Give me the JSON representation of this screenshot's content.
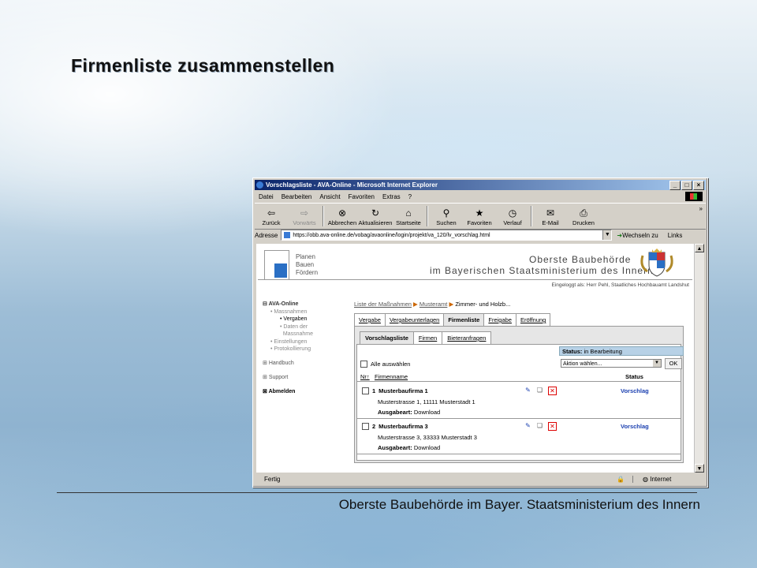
{
  "slide": {
    "title": "Firmenliste zusammenstellen",
    "footer": "Oberste Baubehörde im Bayer. Staatsministerium des Innern"
  },
  "window": {
    "title": "Vorschlagsliste - AVA-Online - Microsoft Internet Explorer",
    "menu": [
      "Datei",
      "Bearbeiten",
      "Ansicht",
      "Favoriten",
      "Extras",
      "?"
    ],
    "toolbar": [
      {
        "label": "Zurück",
        "icon": "back-arrow-icon",
        "glyph": "⇦"
      },
      {
        "label": "Vorwärts",
        "icon": "forward-arrow-icon",
        "glyph": "⇨"
      },
      {
        "label": "Abbrechen",
        "icon": "stop-icon",
        "glyph": "⊗"
      },
      {
        "label": "Aktualisieren",
        "icon": "refresh-icon",
        "glyph": "↻"
      },
      {
        "label": "Startseite",
        "icon": "home-icon",
        "glyph": "⌂"
      },
      {
        "label": "Suchen",
        "icon": "search-icon",
        "glyph": "⚲"
      },
      {
        "label": "Favoriten",
        "icon": "favorites-icon",
        "glyph": "★"
      },
      {
        "label": "Verlauf",
        "icon": "history-icon",
        "glyph": "◷"
      },
      {
        "label": "E-Mail",
        "icon": "mail-icon",
        "glyph": "✉"
      },
      {
        "label": "Drucken",
        "icon": "print-icon",
        "glyph": "⎙"
      }
    ],
    "toolbar_more": "»",
    "address_label": "Adresse",
    "address_url": "https://obb.ava-online.de/vobag/avaonline/login/projekt/va_120/lv_vorschlag.html",
    "go_label": "Wechseln zu",
    "links_label": "Links",
    "status_done": "Fertig",
    "status_zone": "Internet"
  },
  "page": {
    "logo_lines": [
      "Planen",
      "Bauen",
      "Fördern"
    ],
    "header_line1": "Oberste Baubehörde",
    "header_line2": "im Bayerischen Staatsministerium des Innern",
    "logged_in": "Eingeloggt als: Herr Pehl, Staatliches Hochbauamt Landshut",
    "nav": {
      "ava": "AVA-Online",
      "massnahmen": "Massnahmen",
      "vergaben": "Vergaben",
      "daten1": "Daten der",
      "daten2": "Massnahme",
      "einstellungen": "Einstellungen",
      "protokollierung": "Protokollierung",
      "handbuch": "Handbuch",
      "support": "Support",
      "abmelden": "Abmelden"
    },
    "breadcrumb": [
      "Liste der Maßnahmen",
      "Musteramt",
      "Zimmer- und Holzb..."
    ],
    "tabs": [
      "Vergabe",
      "Vergabeunterlagen",
      "Firmenliste",
      "Freigabe",
      "Eröffnung"
    ],
    "active_tab": "Firmenliste",
    "subtabs": [
      "Vorschlagsliste",
      "Firmen",
      "Bieteranfragen"
    ],
    "status_label": "Status:",
    "status_value": "in Bearbeitung",
    "select_all": "Alle auswählen",
    "action_placeholder": "Aktion wählen...",
    "ok_label": "OK",
    "col_nr": "Nr↑",
    "col_name": "Firmenname",
    "col_status": "Status",
    "rows": [
      {
        "nr": "1",
        "name": "Musterbaufirma 1",
        "address": "Musterstrasse 1, 11111 Musterstadt 1",
        "ausgabe_label": "Ausgabeart:",
        "ausgabe_value": "Download",
        "status": "Vorschlag"
      },
      {
        "nr": "2",
        "name": "Musterbaufirma 3",
        "address": "Musterstrasse 3, 33333 Musterstadt 3",
        "ausgabe_label": "Ausgabeart:",
        "ausgabe_value": "Download",
        "status": "Vorschlag"
      }
    ]
  }
}
